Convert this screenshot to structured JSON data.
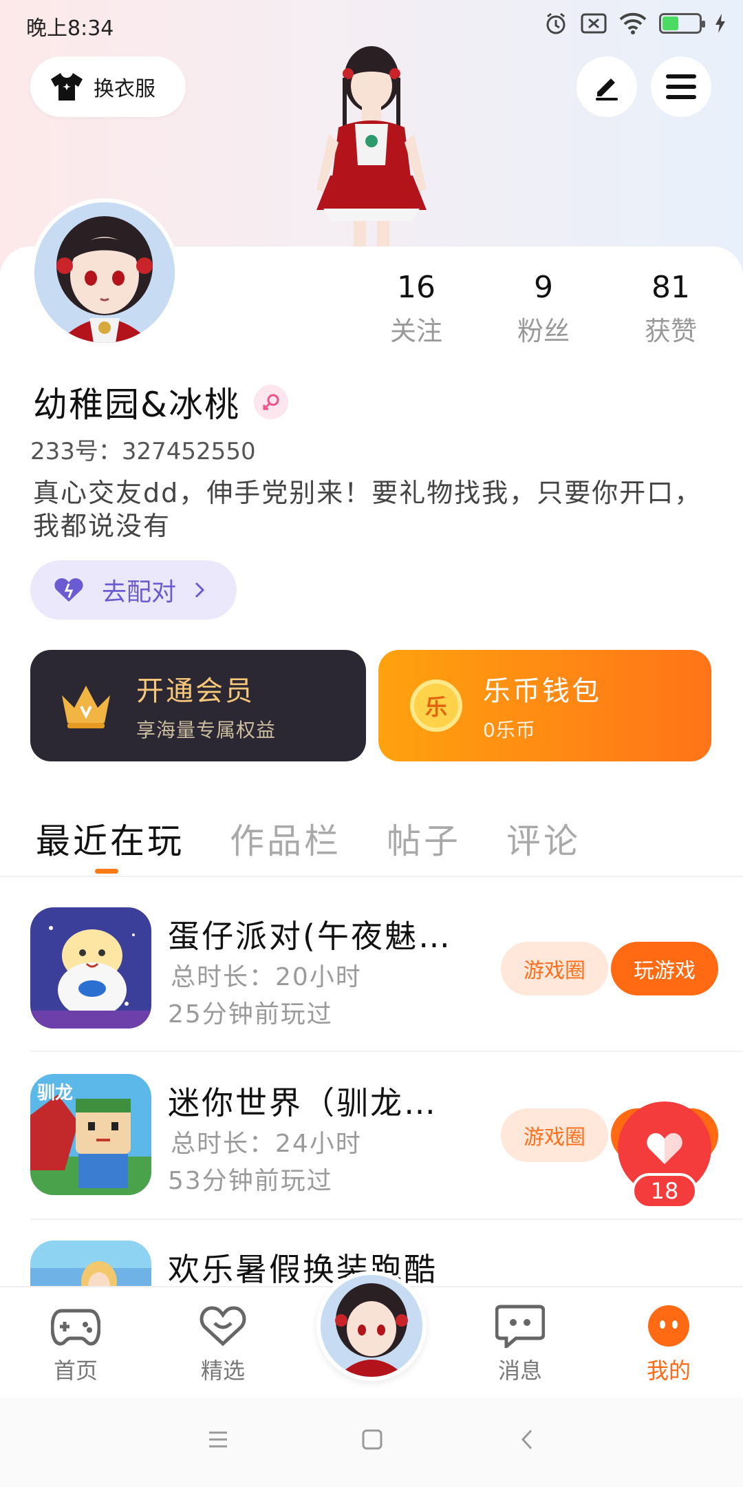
{
  "status": {
    "time": "晚上8:34"
  },
  "header": {
    "outfit_label": "换衣服"
  },
  "profile": {
    "stats": [
      {
        "num": "16",
        "label": "关注"
      },
      {
        "num": "9",
        "label": "粉丝"
      },
      {
        "num": "81",
        "label": "获赞"
      }
    ],
    "name": "幼稚园&冰桃",
    "uid": "233号：327452550",
    "bio": "真心交友dd，伸手党别来！要礼物找我，只要你开口，我都说没有",
    "match_label": "去配对"
  },
  "vip": {
    "title": "开通会员",
    "subtitle": "享海量专属权益"
  },
  "wallet": {
    "title": "乐币钱包",
    "subtitle": "0乐币",
    "coin_char": "乐"
  },
  "tabs": [
    "最近在玩",
    "作品栏",
    "帖子",
    "评论"
  ],
  "games": [
    {
      "title": "蛋仔派对(午夜魅…",
      "duration": "总时长：20小时",
      "last_played": "25分钟前玩过",
      "circle_label": "游戏圈",
      "play_label": "玩游戏"
    },
    {
      "title": "迷你世界（驯龙…",
      "duration": "总时长：24小时",
      "last_played": "53分钟前玩过",
      "circle_label": "游戏圈",
      "play_label": "玩游戏"
    },
    {
      "title": "欢乐暑假换装跑酷",
      "duration": "",
      "last_played": "",
      "circle_label": "",
      "play_label": ""
    }
  ],
  "like": {
    "count": "18"
  },
  "nav": [
    {
      "label": "首页"
    },
    {
      "label": "精选"
    },
    {
      "label": "消息"
    },
    {
      "label": "我的"
    }
  ],
  "colors": {
    "accent": "#ff6a13",
    "purple": "#6b5bd2",
    "like_red": "#f53c3c"
  }
}
